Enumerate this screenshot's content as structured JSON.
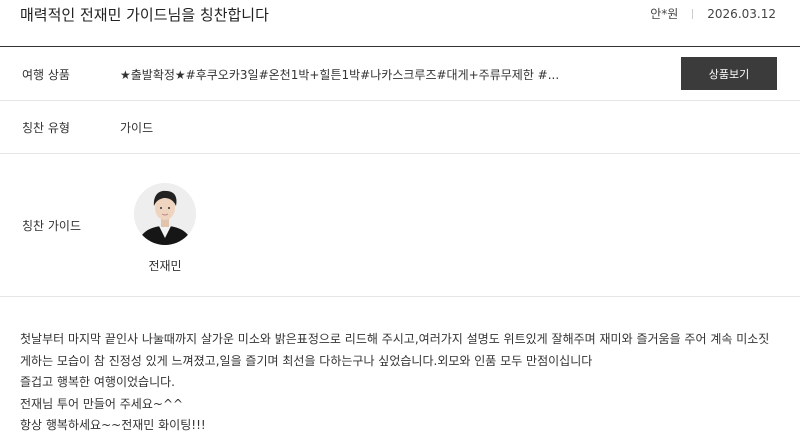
{
  "header": {
    "title": "매력적인 전재민 가이드님을 칭찬합니다",
    "author": "안*원",
    "date": "2026.03.12"
  },
  "fields": {
    "product_label": "여행 상품",
    "product_value": "★출발확정★#후쿠오카3일#온천1박+힐튼1박#나카스크루즈#대게+주류무제한 #...",
    "product_button": "상품보기",
    "type_label": "칭찬 유형",
    "type_value": "가이드",
    "guide_label": "칭찬 가이드",
    "guide_name": "전재민"
  },
  "review": {
    "lines": [
      "첫날부터 마지막 끝인사 나눌때까지 살가운 미소와 밝은표정으로 리드해 주시고,여러가지 설명도 위트있게 잘해주며 재미와 즐거움을 주어 계속 미소짓",
      "게하는 모습이 참 진정성 있게 느껴졌고,일을 즐기며 최선을 다하는구나 싶었습니다.외모와 인품 모두 만점이십니다",
      "즐겁고 행복한 여행이었습니다.",
      "전재님 투어 만들어 주세요~^^",
      "항상 행복하세요~~전재민 화이팅!!!"
    ]
  }
}
